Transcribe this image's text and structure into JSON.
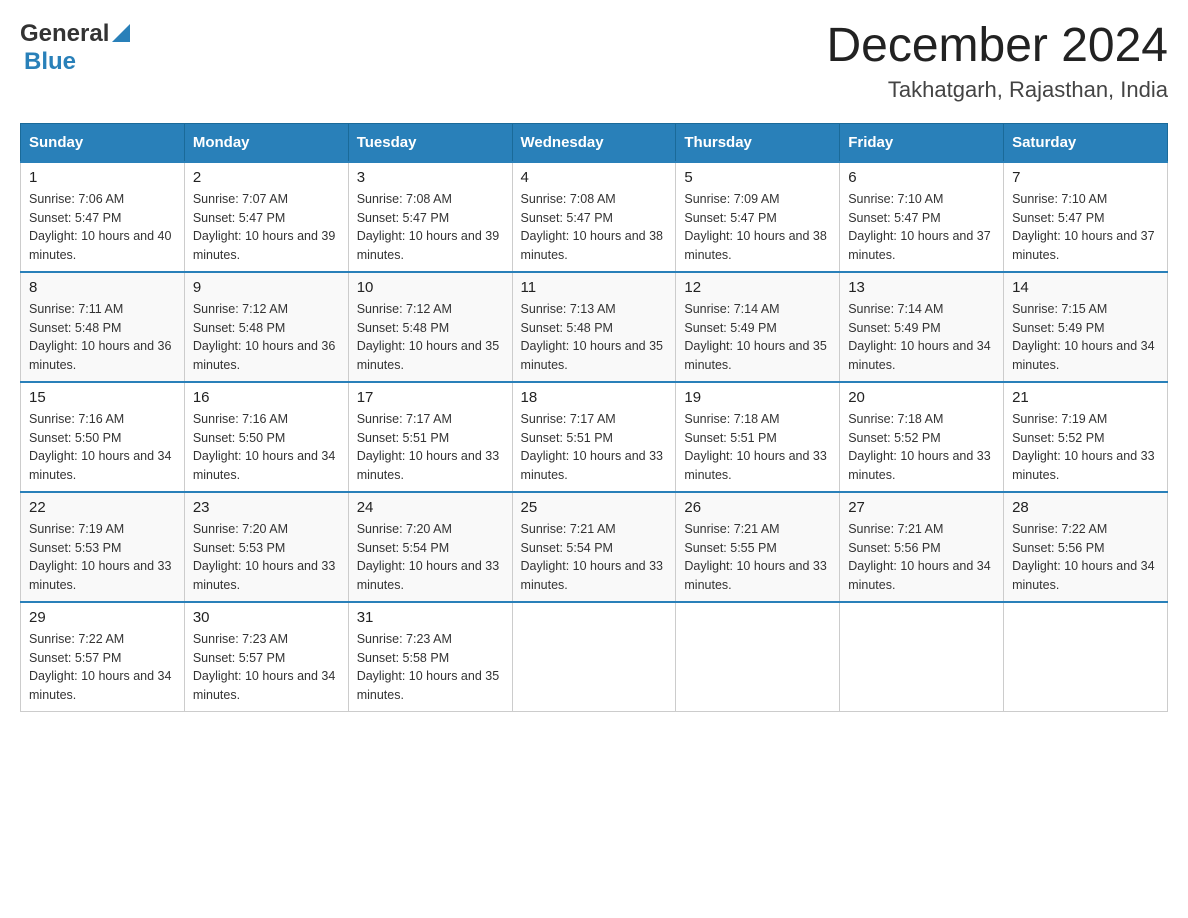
{
  "header": {
    "logo_general": "General",
    "logo_blue": "Blue",
    "month_year": "December 2024",
    "location": "Takhatgarh, Rajasthan, India"
  },
  "weekdays": [
    "Sunday",
    "Monday",
    "Tuesday",
    "Wednesday",
    "Thursday",
    "Friday",
    "Saturday"
  ],
  "weeks": [
    [
      {
        "day": "1",
        "sunrise": "7:06 AM",
        "sunset": "5:47 PM",
        "daylight": "10 hours and 40 minutes."
      },
      {
        "day": "2",
        "sunrise": "7:07 AM",
        "sunset": "5:47 PM",
        "daylight": "10 hours and 39 minutes."
      },
      {
        "day": "3",
        "sunrise": "7:08 AM",
        "sunset": "5:47 PM",
        "daylight": "10 hours and 39 minutes."
      },
      {
        "day": "4",
        "sunrise": "7:08 AM",
        "sunset": "5:47 PM",
        "daylight": "10 hours and 38 minutes."
      },
      {
        "day": "5",
        "sunrise": "7:09 AM",
        "sunset": "5:47 PM",
        "daylight": "10 hours and 38 minutes."
      },
      {
        "day": "6",
        "sunrise": "7:10 AM",
        "sunset": "5:47 PM",
        "daylight": "10 hours and 37 minutes."
      },
      {
        "day": "7",
        "sunrise": "7:10 AM",
        "sunset": "5:47 PM",
        "daylight": "10 hours and 37 minutes."
      }
    ],
    [
      {
        "day": "8",
        "sunrise": "7:11 AM",
        "sunset": "5:48 PM",
        "daylight": "10 hours and 36 minutes."
      },
      {
        "day": "9",
        "sunrise": "7:12 AM",
        "sunset": "5:48 PM",
        "daylight": "10 hours and 36 minutes."
      },
      {
        "day": "10",
        "sunrise": "7:12 AM",
        "sunset": "5:48 PM",
        "daylight": "10 hours and 35 minutes."
      },
      {
        "day": "11",
        "sunrise": "7:13 AM",
        "sunset": "5:48 PM",
        "daylight": "10 hours and 35 minutes."
      },
      {
        "day": "12",
        "sunrise": "7:14 AM",
        "sunset": "5:49 PM",
        "daylight": "10 hours and 35 minutes."
      },
      {
        "day": "13",
        "sunrise": "7:14 AM",
        "sunset": "5:49 PM",
        "daylight": "10 hours and 34 minutes."
      },
      {
        "day": "14",
        "sunrise": "7:15 AM",
        "sunset": "5:49 PM",
        "daylight": "10 hours and 34 minutes."
      }
    ],
    [
      {
        "day": "15",
        "sunrise": "7:16 AM",
        "sunset": "5:50 PM",
        "daylight": "10 hours and 34 minutes."
      },
      {
        "day": "16",
        "sunrise": "7:16 AM",
        "sunset": "5:50 PM",
        "daylight": "10 hours and 34 minutes."
      },
      {
        "day": "17",
        "sunrise": "7:17 AM",
        "sunset": "5:51 PM",
        "daylight": "10 hours and 33 minutes."
      },
      {
        "day": "18",
        "sunrise": "7:17 AM",
        "sunset": "5:51 PM",
        "daylight": "10 hours and 33 minutes."
      },
      {
        "day": "19",
        "sunrise": "7:18 AM",
        "sunset": "5:51 PM",
        "daylight": "10 hours and 33 minutes."
      },
      {
        "day": "20",
        "sunrise": "7:18 AM",
        "sunset": "5:52 PM",
        "daylight": "10 hours and 33 minutes."
      },
      {
        "day": "21",
        "sunrise": "7:19 AM",
        "sunset": "5:52 PM",
        "daylight": "10 hours and 33 minutes."
      }
    ],
    [
      {
        "day": "22",
        "sunrise": "7:19 AM",
        "sunset": "5:53 PM",
        "daylight": "10 hours and 33 minutes."
      },
      {
        "day": "23",
        "sunrise": "7:20 AM",
        "sunset": "5:53 PM",
        "daylight": "10 hours and 33 minutes."
      },
      {
        "day": "24",
        "sunrise": "7:20 AM",
        "sunset": "5:54 PM",
        "daylight": "10 hours and 33 minutes."
      },
      {
        "day": "25",
        "sunrise": "7:21 AM",
        "sunset": "5:54 PM",
        "daylight": "10 hours and 33 minutes."
      },
      {
        "day": "26",
        "sunrise": "7:21 AM",
        "sunset": "5:55 PM",
        "daylight": "10 hours and 33 minutes."
      },
      {
        "day": "27",
        "sunrise": "7:21 AM",
        "sunset": "5:56 PM",
        "daylight": "10 hours and 34 minutes."
      },
      {
        "day": "28",
        "sunrise": "7:22 AM",
        "sunset": "5:56 PM",
        "daylight": "10 hours and 34 minutes."
      }
    ],
    [
      {
        "day": "29",
        "sunrise": "7:22 AM",
        "sunset": "5:57 PM",
        "daylight": "10 hours and 34 minutes."
      },
      {
        "day": "30",
        "sunrise": "7:23 AM",
        "sunset": "5:57 PM",
        "daylight": "10 hours and 34 minutes."
      },
      {
        "day": "31",
        "sunrise": "7:23 AM",
        "sunset": "5:58 PM",
        "daylight": "10 hours and 35 minutes."
      },
      null,
      null,
      null,
      null
    ]
  ]
}
